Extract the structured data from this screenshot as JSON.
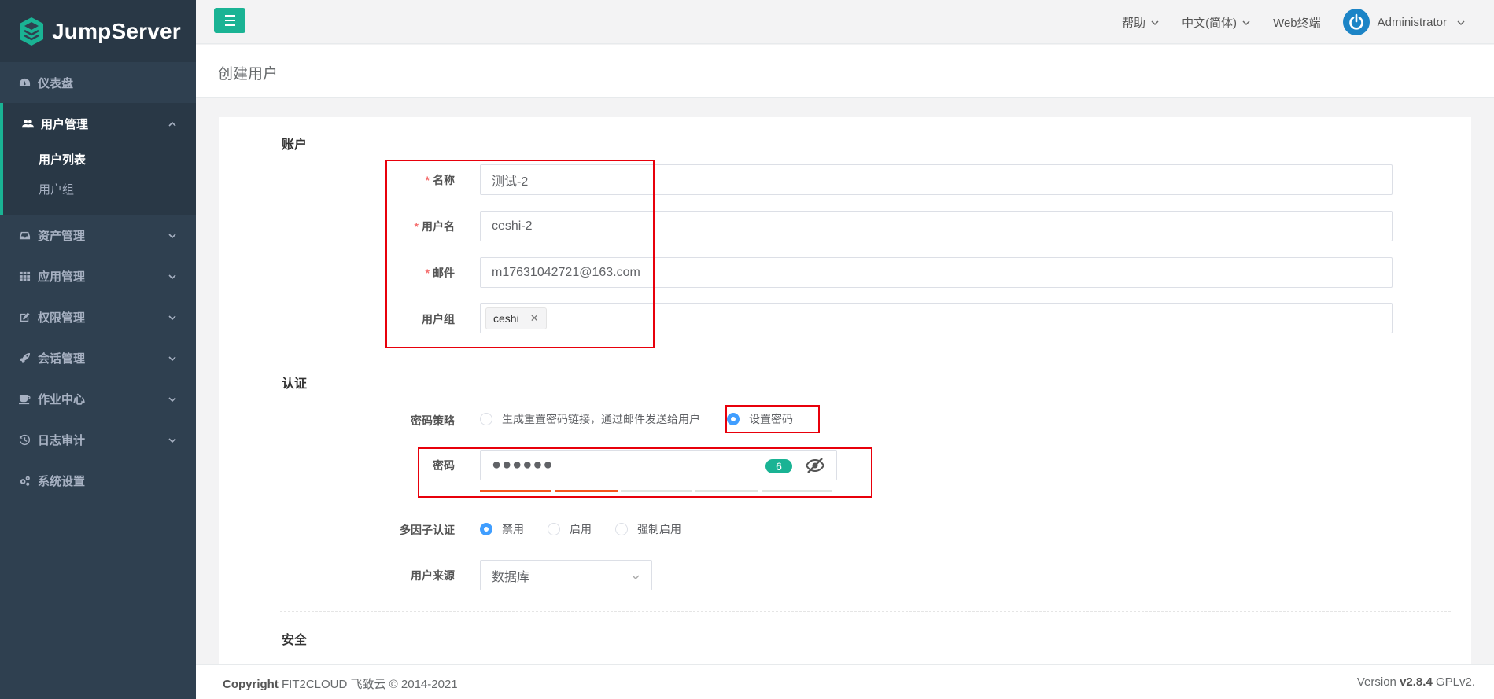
{
  "app": {
    "logo_text": "JumpServer"
  },
  "sidebar": {
    "items": [
      {
        "label": "仪表盘",
        "icon": "dashboard-icon"
      },
      {
        "label": "用户管理",
        "icon": "users-icon",
        "expanded": true,
        "children": [
          {
            "label": "用户列表",
            "active": true
          },
          {
            "label": "用户组"
          }
        ]
      },
      {
        "label": "资产管理",
        "icon": "inbox-icon"
      },
      {
        "label": "应用管理",
        "icon": "grid-icon"
      },
      {
        "label": "权限管理",
        "icon": "edit-icon"
      },
      {
        "label": "会话管理",
        "icon": "rocket-icon"
      },
      {
        "label": "作业中心",
        "icon": "coffee-icon"
      },
      {
        "label": "日志审计",
        "icon": "history-icon"
      },
      {
        "label": "系统设置",
        "icon": "gears-icon"
      }
    ]
  },
  "topbar": {
    "help": "帮助",
    "language": "中文(简体)",
    "web_terminal": "Web终端",
    "user": "Administrator"
  },
  "page": {
    "title": "创建用户"
  },
  "form": {
    "account": {
      "title": "账户",
      "name_label": "名称",
      "name_value": "测试-2",
      "username_label": "用户名",
      "username_value": "ceshi-2",
      "email_label": "邮件",
      "email_value": "m17631042721@163.com",
      "groups_label": "用户组",
      "groups": [
        "ceshi"
      ]
    },
    "auth": {
      "title": "认证",
      "password_strategy_label": "密码策略",
      "password_strategy_options": [
        "生成重置密码链接，通过邮件发送给用户",
        "设置密码"
      ],
      "password_strategy_selected": "设置密码",
      "password_label": "密码",
      "password_masked": "●●●●●●",
      "password_length": "6",
      "password_strength_level": 2,
      "password_strength_segments": 5,
      "mfa_label": "多因子认证",
      "mfa_options": [
        "禁用",
        "启用",
        "强制启用"
      ],
      "mfa_selected": "禁用",
      "source_label": "用户来源",
      "source_value": "数据库"
    },
    "security": {
      "title": "安全"
    }
  },
  "footer": {
    "copyright_label": "Copyright",
    "copyright_text": "FIT2CLOUD 飞致云 © 2014-2021",
    "version_label": "Version",
    "version": "v2.8.4",
    "license": "GPLv2."
  },
  "colors": {
    "accent": "#1ab394",
    "sidebar": "#2f4050",
    "radio": "#409eff",
    "highlight": "#e8000b",
    "strength_on": "#f5541d"
  }
}
